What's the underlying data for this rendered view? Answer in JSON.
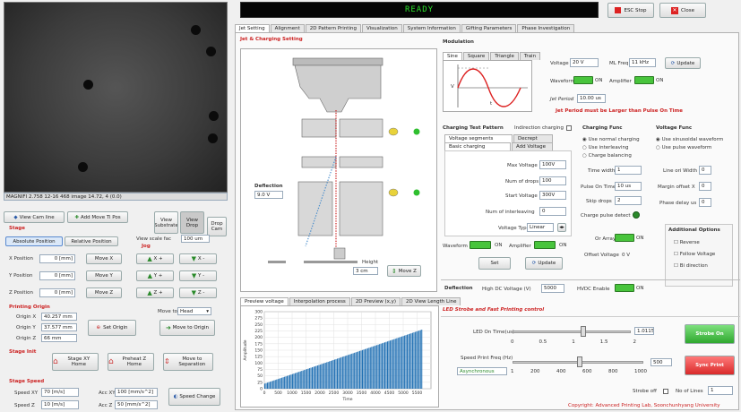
{
  "status": {
    "ready": "READY"
  },
  "top_buttons": {
    "estop": "ESC Stop",
    "close": "Close"
  },
  "camera": {
    "info": "MAGNIFI 2.758 12-16 468 image 14.72, 4 (0.0)"
  },
  "view_buttons": {
    "view_cam": "View Cam line",
    "add_move": "Add Move Ti Pos",
    "view_substrate": "View Substrate",
    "view_drop": "View Drop",
    "cam_on": "Drop Cam"
  },
  "stage": {
    "title": "Stage",
    "abs_pos": "Absolute Position",
    "rel_pos": "Relative Position",
    "view_scale_label": "View scale fac",
    "view_scale_val": "100 um",
    "jog_label": "Jog",
    "x_label": "X Position",
    "x_val": "0 [mm]",
    "y_label": "Y Position",
    "y_val": "0 [mm]",
    "z_label": "Z Position",
    "z_val": "0 [mm]",
    "move_x": "Move X",
    "move_y": "Move Y",
    "move_z": "Move Z",
    "xp": "X +",
    "xm": "X -",
    "yp": "Y +",
    "ym": "Y -",
    "zp": "Z +",
    "zm": "Z -"
  },
  "origin": {
    "title": "Printing Origin",
    "ox_label": "Origin X",
    "ox_val": "40.257 mm",
    "oy_label": "Origin Y",
    "oy_val": "37.577 mm",
    "oz_label": "Origin Z",
    "oz_val": "66 mm",
    "set_origin": "Set Origin",
    "move_to": "Move to",
    "move_to_sel": "Head",
    "move_to_origin": "Move to Origin"
  },
  "stage_init": {
    "title": "Stage Init",
    "home": "Stage XY Home",
    "preheat": "Preheat Z Home",
    "move_sep": "Move to Separation"
  },
  "stage_speed": {
    "title": "Stage Speed",
    "speed_xy_label": "Speed XY",
    "speed_xy_val": "70 [m/s]",
    "acc_xy_label": "Acc XY",
    "acc_xy_val": "100 [mm/s^2]",
    "speed_z_label": "Speed Z",
    "speed_z_val": "10 [m/s]",
    "acc_z_label": "Acc Z",
    "acc_z_val": "50 [mm/s^2]",
    "speed_change": "Speed Change"
  },
  "main_tabs": [
    "Jet Setting",
    "Alignment",
    "2D Pattern Printing",
    "Visualization",
    "System Information",
    "Gifting Parameters",
    "Phase Investigation"
  ],
  "jet": {
    "title": "Jet & Charging Setting",
    "deflection_label": "Deflection",
    "deflection_val": "9.0 V",
    "height_label": "Height",
    "height_val": "3 cm",
    "move_z": "Move Z"
  },
  "modulation": {
    "title": "Modulation",
    "tabs": [
      "Sine",
      "Square",
      "Triangle",
      "Train"
    ],
    "voltage_label": "Voltage",
    "voltage_val": "20 V",
    "ml_freq_label": "ML Freq",
    "ml_freq_val": "11 kHz",
    "update": "Update",
    "waveform_label": "Waveform",
    "waveform_on": "ON",
    "amplifier_label": "Amplifier",
    "amplifier_on": "ON",
    "jet_period_label": "Jet Period",
    "jet_period_val": "10.00 us",
    "period_note": "Jet Period must be Larger than Pulse On Time",
    "axis_v": "V",
    "axis_t": "t"
  },
  "charging_pattern": {
    "title": "Charging Test Pattern",
    "indirect_label": "Indirection charging",
    "tabs_top": [
      "Voltage segments",
      "Decrept"
    ],
    "tabs_bottom": [
      "Basic charging",
      "Add Voltage"
    ],
    "max_voltage_label": "Max Voltage",
    "max_voltage_val": "100V",
    "num_drops_label": "Num of drops",
    "num_drops_val": "100",
    "start_voltage_label": "Start Voltage",
    "start_voltage_val": "300V",
    "num_interleave_label": "Num of interleaving",
    "num_interleave_val": "0",
    "voltage_type_label": "Voltage Type",
    "voltage_type_val": "Linear"
  },
  "charging_func": {
    "title": "Charging Func",
    "opts": [
      "Use normal charging",
      "Use interleaving",
      "Charge balancing"
    ],
    "time_width_label": "Time width",
    "time_width_val": "1",
    "pulse_on_label": "Pulse On Time",
    "pulse_on_val": "10 us",
    "skip_drops_label": "Skip drops",
    "skip_drops_val": "2",
    "charge_pulse_label": "Charge pulse detect",
    "or_array_label": "Or Array",
    "or_array_on": "ON",
    "offset_voltage_label": "Offset Voltage",
    "offset_voltage_val": "0 V"
  },
  "voltage_func": {
    "title": "Voltage Func",
    "opts": [
      "Use sinusoidal waveform",
      "Use pulse waveform"
    ],
    "line_ori_label": "Line ori Width",
    "line_ori_val": "0",
    "margin_offset_label": "Margin offset X",
    "margin_offset_val": "0",
    "phase_delay_label": "Phase delay us",
    "phase_delay_val": "0"
  },
  "add_options": {
    "title": "Additional Options",
    "opts": [
      "Reverse",
      "Follow Voltage",
      "Bi direction"
    ]
  },
  "waveform_bar": {
    "waveform_label": "Waveform",
    "waveform_on": "ON",
    "amplifier_label": "Amplifier",
    "amplifier_on": "ON",
    "set": "Set",
    "update": "Update"
  },
  "deflection_bar": {
    "label": "Deflection",
    "hv_label": "High DC Voltage (V)",
    "hv_val": "5000",
    "hv_enable_label": "HVDC Enable",
    "hv_on": "ON"
  },
  "led": {
    "title": "LED Strobe and Fast Printing control",
    "led_on_label": "LED On Time(us)",
    "led_scale": [
      "0",
      "0.5",
      "1",
      "1.5",
      "2"
    ],
    "led_val": "1.0115",
    "strobe_on": "Strobe On",
    "speed_label": "Speed Print Freq (Hz)",
    "speed_scale": [
      "1",
      "200",
      "400",
      "600",
      "800",
      "1000"
    ],
    "speed_val": "500",
    "speed_sub": "Asynchronous",
    "sync_print": "Sync Print",
    "strobe_off_label": "Strobe off",
    "num_of_label": "No of Lines",
    "num_of_val": "1"
  },
  "chart_tabs": [
    "Preview voltage",
    "Interpolation process",
    "2D Preview (x,y)",
    "2D View Length Line"
  ],
  "chart_data": {
    "type": "bar",
    "xlabel": "Time",
    "ylabel": "Amplitude",
    "xlim": [
      0,
      6000
    ],
    "ylim": [
      0,
      300
    ],
    "x_ticks": [
      "0",
      "500",
      "1000",
      "1500",
      "2000",
      "2500",
      "3000",
      "3500",
      "4000",
      "4500",
      "5000",
      "5500"
    ],
    "y_ticks": [
      "0",
      "25",
      "50",
      "75",
      "100",
      "125",
      "150",
      "175",
      "200",
      "225",
      "250",
      "275",
      "300"
    ],
    "x_range": [
      0,
      5700
    ],
    "values_start": 20,
    "values_end": 230,
    "color": "#1f6fb3"
  },
  "copyright": "Copyright: Advanced Printing Lab, Soonchunhyang University"
}
